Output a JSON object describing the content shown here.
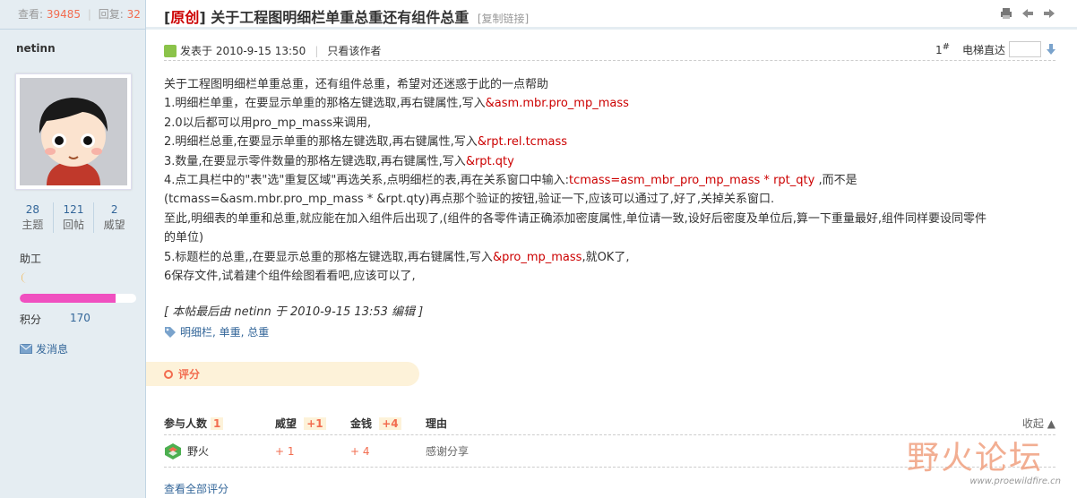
{
  "stats_bar": {
    "views_label": "查看:",
    "views": "39485",
    "replies_label": "回复:",
    "replies": "32"
  },
  "thread": {
    "tag_open": "[",
    "tag": "原创",
    "tag_close": "]",
    "title": "关于工程图明细栏单重总重还有组件总重",
    "copy_link": "[复制链接]"
  },
  "author": {
    "name": "netinn",
    "topics": "28",
    "topics_label": "主题",
    "posts": "121",
    "posts_label": "回帖",
    "prestige": "2",
    "prestige_label": "威望",
    "rank": "助工",
    "level_progress": 0.82,
    "credit_label": "积分",
    "credit": "170",
    "pm_label": "发消息"
  },
  "post": {
    "posted_at": "发表于 2010-9-15 13:50",
    "only_author": "只看该作者",
    "floor": "1",
    "floor_sup": "#",
    "jump_label": "电梯直达",
    "lines": [
      {
        "a": "关于工程图明细栏单重总重，还有组件总重，希望对还迷惑于此的一点帮助",
        "b": "",
        "c": ""
      },
      {
        "a": "1.明细栏单重，在要显示单重的那格左键选取,再右键属性,写入",
        "b": "&asm.mbr.pro_mp_mass",
        "c": ""
      },
      {
        "a": "2.0以后都可以用pro_mp_mass来调用,",
        "b": "",
        "c": ""
      },
      {
        "a": "2.明细栏总重,在要显示单重的那格左键选取,再右键属性,写入",
        "b": "&rpt.rel.tcmass",
        "c": ""
      },
      {
        "a": "3.数量,在要显示零件数量的那格左键选取,再右键属性,写入",
        "b": "&rpt.qty",
        "c": ""
      },
      {
        "a": "4.点工具栏中的\"表\"选\"重复区域\"再选关系,点明细栏的表,再在关系窗口中输入:",
        "b": "tcmass=asm_mbr_pro_mp_mass * rpt_qty",
        "c": " ,而不是"
      },
      {
        "a": "(tcmass=&asm.mbr.pro_mp_mass * &rpt.qty)再点那个验证的按钮,验证一下,应该可以通过了,好了,关掉关系窗口.",
        "b": "",
        "c": ""
      },
      {
        "a": "至此,明细表的单重和总重,就应能在加入组件后出现了,(组件的各零件请正确添加密度属性,单位请一致,设好后密度及单位后,算一下重量最好,组件同样要设同零件",
        "b": "",
        "c": ""
      },
      {
        "a": "的单位)",
        "b": "",
        "c": ""
      },
      {
        "a": "5.标题栏的总重,,在要显示总重的那格左键选取,再右键属性,写入",
        "b": "&pro_mp_mass",
        "c": ",就OK了,"
      },
      {
        "a": "6保存文件,试着建个组件绘图看看吧,应该可以了,",
        "b": "",
        "c": ""
      }
    ],
    "edited": "[ 本帖最后由 netinn 于 2010-9-15 13:53 编辑 ]",
    "tags": "明细栏, 单重, 总重"
  },
  "rating": {
    "section_label": "评分",
    "col_people": "参与人数",
    "people_count": "1",
    "col_prestige": "威望",
    "prestige_total": "+1",
    "col_money": "金钱",
    "money_total": "+4",
    "col_reason": "理由",
    "collapse": "收起",
    "rows": [
      {
        "user": "野火",
        "prestige": "+ 1",
        "money": "+ 4",
        "reason": "感谢分享"
      }
    ],
    "see_all": "查看全部评分"
  },
  "watermark": {
    "text": "野火论坛",
    "url": "www.proewildfire.cn"
  },
  "colors": {
    "accent_red": "#cc0000",
    "link_blue": "#336699",
    "sidebar_bg": "#e5edf2",
    "orange": "#f26c4f"
  }
}
